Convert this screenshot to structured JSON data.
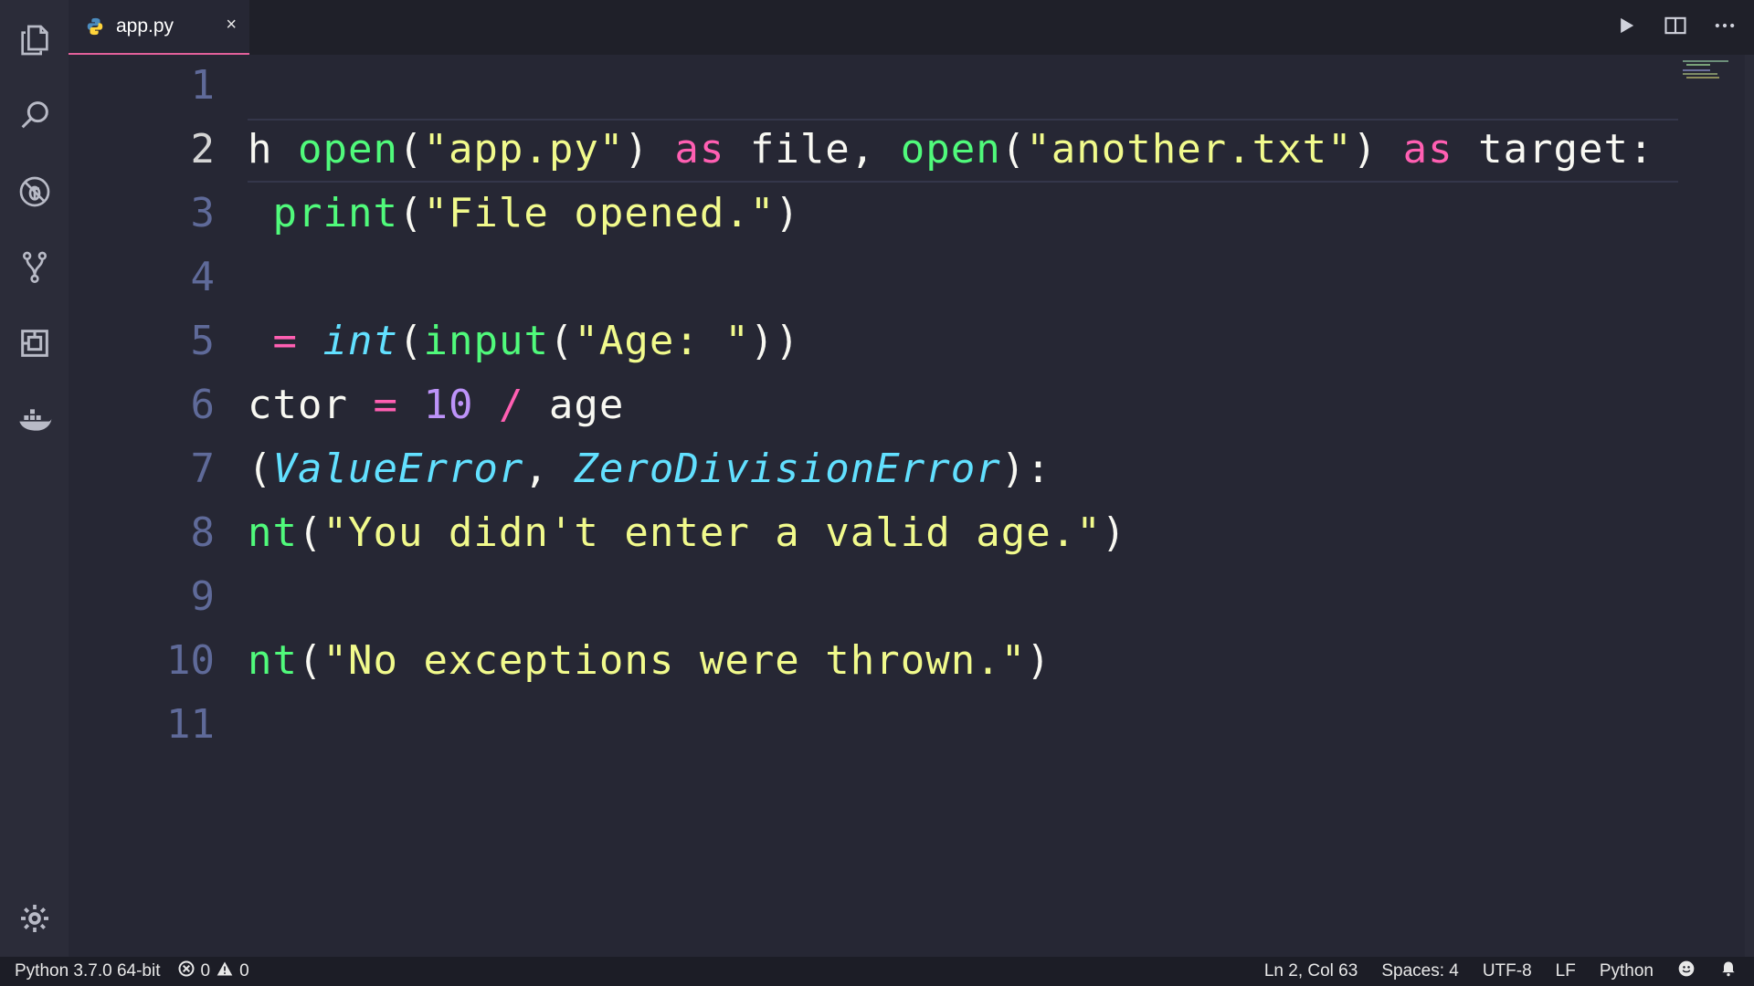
{
  "tab": {
    "file_name": "app.py",
    "close_glyph": "×"
  },
  "gutter": {
    "line_numbers": [
      "1",
      "2",
      "3",
      "4",
      "5",
      "6",
      "7",
      "8",
      "9",
      "10",
      "11"
    ],
    "active_line": "2"
  },
  "code": {
    "l2": [
      "h ",
      "open",
      "(",
      "\"app.py\"",
      ") ",
      "as",
      " file, ",
      "open",
      "(",
      "\"another.txt\"",
      ") ",
      "as",
      " target:"
    ],
    "l3": [
      " ",
      "print",
      "(",
      "\"File opened.\"",
      ")"
    ],
    "l5": [
      " ",
      "=",
      " ",
      "int",
      "(",
      "input",
      "(",
      "\"Age: \"",
      "))"
    ],
    "l6": [
      "ctor ",
      "=",
      " ",
      "10",
      " ",
      "/",
      " age"
    ],
    "l7": [
      "(",
      "ValueError",
      ", ",
      "ZeroDivisionError",
      "):"
    ],
    "l8": [
      "nt",
      "(",
      "\"You didn't enter a valid age.\"",
      ")"
    ],
    "l10": [
      "nt",
      "(",
      "\"No exceptions were thrown.\"",
      ")"
    ]
  },
  "status": {
    "interpreter": "Python 3.7.0 64-bit",
    "errors": "0",
    "warnings": "0",
    "cursor": "Ln 2, Col 63",
    "indent": "Spaces: 4",
    "encoding": "UTF-8",
    "eol": "LF",
    "language": "Python"
  },
  "icons": {
    "activity": [
      "explorer-icon",
      "search-icon",
      "debug-icon",
      "source-control-icon",
      "extensions-icon",
      "docker-icon",
      "settings-gear-icon"
    ],
    "top": [
      "run-icon",
      "split-editor-icon",
      "more-actions-icon"
    ],
    "status": [
      "error-icon",
      "warning-icon",
      "feedback-smiley-icon",
      "notifications-bell-icon"
    ]
  },
  "colors": {
    "background": "#262734",
    "keyword": "#ff5fb2",
    "function": "#50fa7b",
    "string": "#f1fa8c",
    "number": "#bd93f9",
    "class": "#62e0ff",
    "line_number": "#5f6a99",
    "tab_accent": "#e2609a"
  }
}
